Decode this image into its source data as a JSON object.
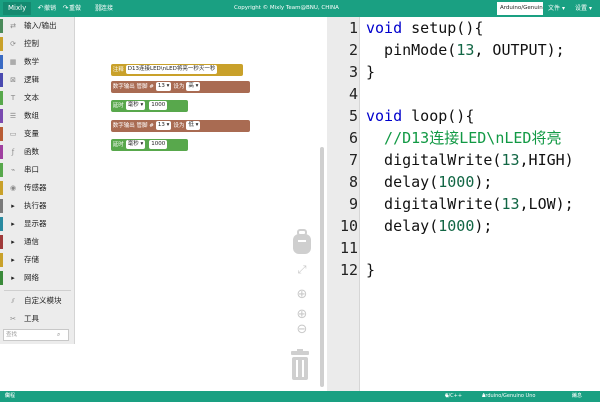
{
  "topbar": {
    "app_name": "Mixly",
    "undo_label": "撤销",
    "redo_label": "重做",
    "connect_label": "连接",
    "copyright": "Copyright © Mixly Team@BNU, CHINA",
    "board": "Arduino/Genuino",
    "file_menu": "文件",
    "settings_menu": "设置"
  },
  "sidebar": {
    "categories": [
      {
        "label": "输入/输出",
        "color": "#4a8a5a"
      },
      {
        "label": "控制",
        "color": "#c9a12a"
      },
      {
        "label": "数学",
        "color": "#3a6bc4"
      },
      {
        "label": "逻辑",
        "color": "#4a4ab0"
      },
      {
        "label": "文本",
        "color": "#58a84c"
      },
      {
        "label": "数组",
        "color": "#7a4ab0"
      },
      {
        "label": "变量",
        "color": "#b85c35"
      },
      {
        "label": "函数",
        "color": "#a040a0"
      },
      {
        "label": "串口",
        "color": "#58a84c"
      },
      {
        "label": "传感器",
        "color": "#c9a12a"
      },
      {
        "label": "执行器",
        "color": "#7a7a7a"
      },
      {
        "label": "显示器",
        "color": "#2a8aa0"
      },
      {
        "label": "通信",
        "color": "#a03a3a"
      },
      {
        "label": "存储",
        "color": "#c9a12a"
      },
      {
        "label": "网络",
        "color": "#3a8a3a"
      }
    ],
    "custom_label": "自定义模块",
    "tools_label": "工具",
    "search_placeholder": "查找"
  },
  "workspace": {
    "comment_label": "注释",
    "comment_text": "D13连接LED\\nLED将亮一秒灭一秒",
    "digital_write_label": "数字输出 管脚 #",
    "pin_value": "13",
    "set_to_label": "设为",
    "high_value": "高",
    "low_value": "低",
    "delay_label": "延时",
    "ms_unit": "毫秒",
    "delay_value": "1000",
    "block_colors": {
      "comment": "#c9a12a",
      "digital": "#a96b52",
      "delay": "#58a84c"
    }
  },
  "editor": {
    "lines": [
      "1",
      "2",
      "3",
      "4",
      "5",
      "6",
      "7",
      "8",
      "9",
      "10",
      "11",
      "12"
    ],
    "code": {
      "l1_kw": "void",
      "l1_rest": " setup(){",
      "l2_a": "  pinMode(",
      "l2_num": "13",
      "l2_b": ", OUTPUT);",
      "l3": "}",
      "l5_kw": "void",
      "l5_rest": " loop(){",
      "l6_comment": "  //D13连接LED\\nLED将亮",
      "l7_a": "  digitalWrite(",
      "l7_num": "13",
      "l7_b": ",HIGH)",
      "l8_a": "  delay(",
      "l8_num": "1000",
      "l8_b": ");",
      "l9_a": "  digitalWrite(",
      "l9_num": "13",
      "l9_b": ",LOW);",
      "l10_a": "  delay(",
      "l10_num": "1000",
      "l10_b": ");",
      "l12": "}"
    }
  },
  "statusbar": {
    "example_label": "例程",
    "lang": "C/C++",
    "board": "Arduino/Genuino Uno",
    "message_label": "消息"
  }
}
